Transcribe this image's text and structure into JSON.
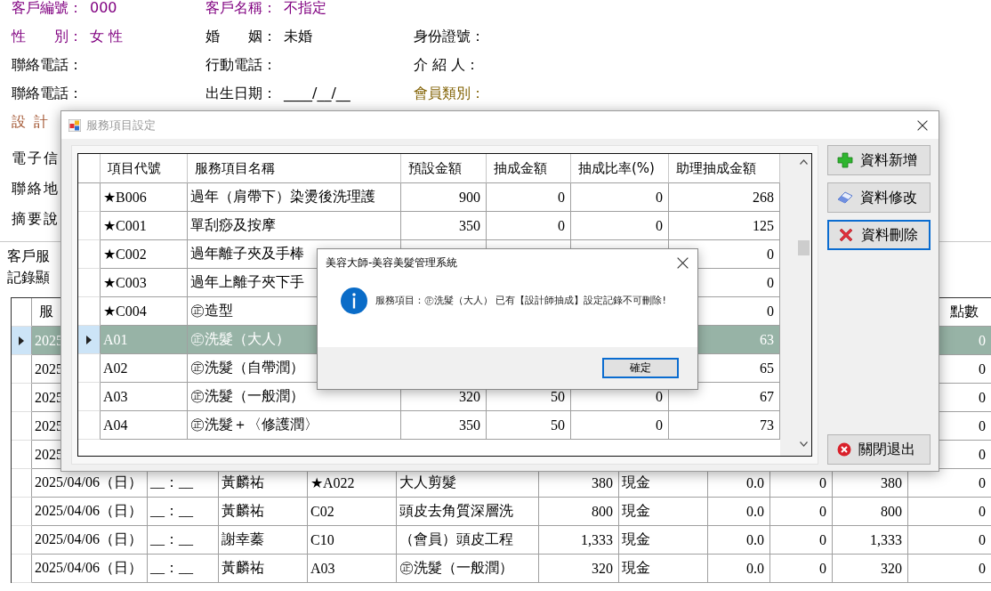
{
  "customer_form": {
    "rows": [
      [
        {
          "label": "客戶編號：",
          "value": "000",
          "color": "#800080"
        },
        {
          "label": "客戶名稱：",
          "value": "不指定",
          "color": "#800080"
        }
      ],
      [
        {
          "label": "性　　別：",
          "value": "女 性",
          "color": "#800080"
        },
        {
          "label": "婚　　姻：",
          "value": "未婚",
          "color": "#000000"
        },
        {
          "label": "身份證號：",
          "color": "#000000"
        }
      ],
      [
        {
          "label": "聯絡電話：",
          "color": "#000000"
        },
        {
          "label": "行動電話：",
          "color": "#000000"
        },
        {
          "label": "介 紹 人：",
          "color": "#000000"
        }
      ],
      [
        {
          "label": "聯絡電話：",
          "color": "#000000"
        },
        {
          "label": "出生日期：",
          "value": "____/__/__",
          "color": "#000000"
        },
        {
          "label": "會員類別：",
          "color": "#806000"
        }
      ]
    ],
    "side_labels": [
      {
        "text": "設 計",
        "color": "#a0522d"
      },
      {
        "text": "電子信",
        "color": "#000000"
      },
      {
        "text": "聯絡地",
        "color": "#000000"
      },
      {
        "text": "摘要說",
        "color": "#000000"
      }
    ],
    "section_labels": [
      "客戶服",
      "記錄顯"
    ]
  },
  "records_grid": {
    "header": {
      "column_1": "服",
      "column_11": "點數"
    },
    "rows": [
      {
        "selected": true,
        "column_1": "2025",
        "column_11": "0"
      },
      {
        "selected": false,
        "column_1": "2025",
        "column_11": "0"
      },
      {
        "selected": false,
        "column_1": "2025",
        "column_11": "0"
      },
      {
        "selected": false,
        "column_1": "2025",
        "column_11": "0"
      },
      {
        "selected": false,
        "column_1": "2025",
        "column_11": "0"
      },
      {
        "selected": false,
        "column_1": "2025/04/06（日）",
        "column_2": "__：__",
        "column_3": "黃麟祐",
        "column_4": "★A022",
        "column_5": "大人剪髮",
        "column_6": "380",
        "column_7": "現金",
        "column_8": "0.0",
        "column_9": "0",
        "column_10": "380",
        "column_11": "0"
      },
      {
        "selected": false,
        "column_1": "2025/04/06（日）",
        "column_2": "__：__",
        "column_3": "黃麟祐",
        "column_4": "C02",
        "column_5": "頭皮去角質深層洗",
        "column_6": "800",
        "column_7": "現金",
        "column_8": "0.0",
        "column_9": "0",
        "column_10": "800",
        "column_11": "0"
      },
      {
        "selected": false,
        "column_1": "2025/04/06（日）",
        "column_2": "__：__",
        "column_3": "謝幸蓁",
        "column_4": "C10",
        "column_5": "（會員）頭皮工程",
        "column_6": "1,333",
        "column_7": "現金",
        "column_8": "0.0",
        "column_9": "0",
        "column_10": "1,333",
        "column_11": "0"
      },
      {
        "selected": false,
        "column_1": "2025/04/06（日）",
        "column_2": "__：__",
        "column_3": "黃麟祐",
        "column_4": "A03",
        "column_5": "㊣洗髮（一般潤）",
        "column_6": "320",
        "column_7": "現金",
        "column_8": "0.0",
        "column_9": "0",
        "column_10": "320",
        "column_11": "0"
      }
    ]
  },
  "service_dialog": {
    "title": "服務項目設定",
    "columns": [
      "項目代號",
      "服務項目名稱",
      "預設金額",
      "抽成金額",
      "抽成比率(%)",
      "助理抽成金額"
    ],
    "rows": [
      {
        "selected": false,
        "code": "★B006",
        "name": "過年（肩帶下）染燙後洗理護",
        "price": "900",
        "commission": "0",
        "rate": "0",
        "assistant": "268"
      },
      {
        "selected": false,
        "code": "★C001",
        "name": "單刮痧及按摩",
        "price": "350",
        "commission": "0",
        "rate": "0",
        "assistant": "125"
      },
      {
        "selected": false,
        "code": "★C002",
        "name": "過年離子夾及手棒",
        "assistant": "0"
      },
      {
        "selected": false,
        "code": "★C003",
        "name": "過年上離子夾下手",
        "assistant": "0"
      },
      {
        "selected": false,
        "code": "★C004",
        "name": "㊣造型",
        "assistant": "0"
      },
      {
        "selected": true,
        "code": "A01",
        "name": "㊣洗髮（大人）",
        "assistant": "63"
      },
      {
        "selected": false,
        "code": "A02",
        "name": "㊣洗髮（自帶潤）",
        "assistant": "65"
      },
      {
        "selected": false,
        "code": "A03",
        "name": "㊣洗髮（一般潤）",
        "price": "320",
        "commission": "50",
        "rate": "0",
        "assistant": "67"
      },
      {
        "selected": false,
        "code": "A04",
        "name": "㊣洗髮＋〈修護潤〉",
        "price": "350",
        "commission": "50",
        "rate": "0",
        "assistant": "73"
      }
    ],
    "buttons": [
      {
        "label": "資料新增",
        "kind": "add",
        "focused": false
      },
      {
        "label": "資料修改",
        "kind": "edit",
        "focused": false
      },
      {
        "label": "資料刪除",
        "kind": "delete",
        "focused": true
      },
      {
        "label": "關閉退出",
        "kind": "exit",
        "focused": false
      }
    ]
  },
  "message_box": {
    "title": "美容大師-美容美髮管理系統",
    "message": "服務項目：㊣洗髮（大人） 已有【設計師抽成】設定記錄不可刪除!",
    "button": "確定"
  }
}
